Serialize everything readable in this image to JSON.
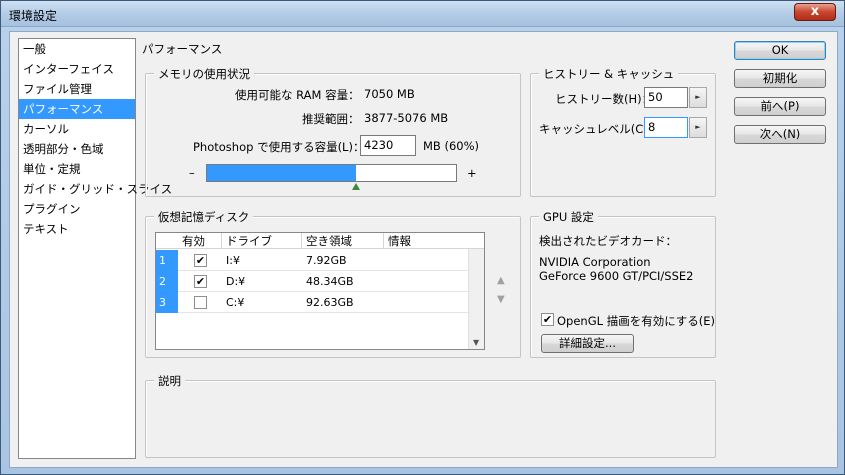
{
  "window": {
    "title": "環境設定",
    "close_label": "x"
  },
  "nav": {
    "items": [
      {
        "label": "一般"
      },
      {
        "label": "インターフェイス"
      },
      {
        "label": "ファイル管理"
      },
      {
        "label": "パフォーマンス"
      },
      {
        "label": "カーソル"
      },
      {
        "label": "透明部分・色域"
      },
      {
        "label": "単位・定規"
      },
      {
        "label": "ガイド・グリッド・スライス"
      },
      {
        "label": "プラグイン"
      },
      {
        "label": "テキスト"
      }
    ],
    "selected_index": 3
  },
  "section_title": "パフォーマンス",
  "memory": {
    "legend": "メモリの使用状況",
    "ram_label": "使用可能な RAM 容量：",
    "ram_value": "7050 MB",
    "range_label": "推奨範囲：",
    "range_value": "3877-5076 MB",
    "usage_label": "Photoshop で使用する容量(L)：",
    "usage_value": "4230",
    "usage_suffix": "MB (60%)",
    "minus": "–",
    "plus": "+",
    "slider_fraction": 0.6
  },
  "history": {
    "legend": "ヒストリー & キャッシュ",
    "history_label": "ヒストリー数(H)：",
    "history_value": "50",
    "cache_label": "キャッシュレベル(C)：",
    "cache_value": "8"
  },
  "scratch": {
    "legend": "仮想記憶ディスク",
    "columns": [
      "有効",
      "ドライブ",
      "空き領域",
      "情報"
    ],
    "rows": [
      {
        "num": "1",
        "enabled": true,
        "drive": "I:¥",
        "free": "7.92GB",
        "info": ""
      },
      {
        "num": "2",
        "enabled": true,
        "drive": "D:¥",
        "free": "48.34GB",
        "info": ""
      },
      {
        "num": "3",
        "enabled": false,
        "drive": "C:¥",
        "free": "92.63GB",
        "info": ""
      }
    ],
    "move_up": "▲",
    "move_down": "▼"
  },
  "gpu": {
    "legend": "GPU 設定",
    "detected_label": "検出されたビデオカード：",
    "vendor": "NVIDIA Corporation",
    "model": "GeForce 9600 GT/PCI/SSE2",
    "opengl_label": "OpenGL 描画を有効にする(E)",
    "opengl_checked": true,
    "advanced_label": "詳細設定..."
  },
  "description": {
    "legend": "説明"
  },
  "buttons": {
    "ok": "OK",
    "reset": "初期化",
    "prev": "前へ(P)",
    "next": "次へ(N)"
  }
}
